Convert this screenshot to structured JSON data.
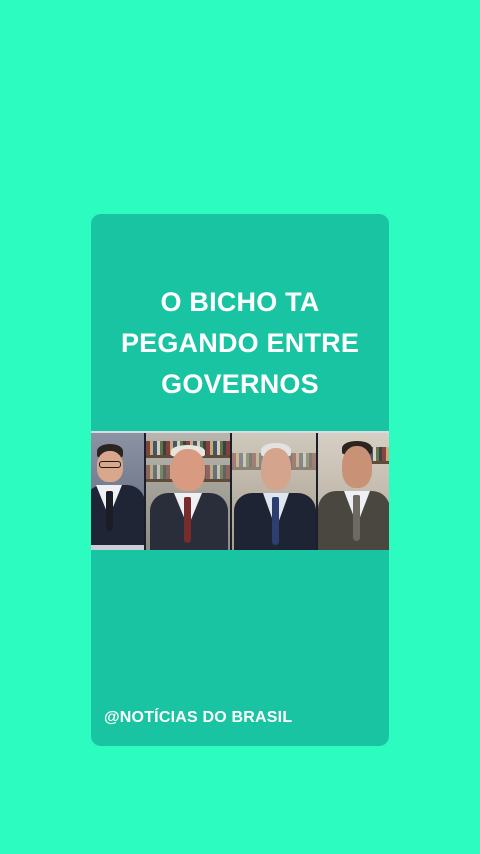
{
  "story": {
    "headline": [
      "O BICHO TA",
      "PEGANDO ENTRE",
      "GOVERNOS"
    ],
    "video_still": "four-panel news broadcast with four men in suits",
    "handle": "@NOTÍCIAS DO BRASIL"
  },
  "colors": {
    "background": "#2cfcc0",
    "card": "#19c4a2",
    "text": "#ffffff"
  }
}
